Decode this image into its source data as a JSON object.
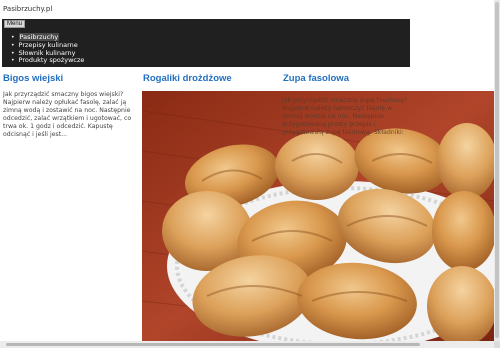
{
  "site": {
    "title": "Pasibrzuchy.pl"
  },
  "nav": {
    "toggle_label": "Menu",
    "items": [
      {
        "label": "Pasibrzuchy",
        "active": true
      },
      {
        "label": "Przepisy kulinarne",
        "active": false
      },
      {
        "label": "Słownik kulinarny",
        "active": false
      },
      {
        "label": "Produkty spożywcze",
        "active": false
      }
    ]
  },
  "posts": [
    {
      "title": "Bigos wiejski",
      "excerpt": "Jak przyrządzić smaczny bigos wiejski? Najpierw należy opłukać fasolę, zalać ją zimną wodą i zostawić na noc. Następnie odcedzić, zalać wrzątkiem i ugotować, co trwa ok. 1 godz i odcedzić. Kapustę odcisnąć i jeśli jest..."
    },
    {
      "title": "Rogaliki drożdżowe",
      "image": "crescent-rolls-photo"
    },
    {
      "title": "Zupa fasolowa",
      "excerpt": "Jak przyrządzić smaczną zupę fasolową? Najpierw należy namoczyć fasolę w zimnej wodzie na noc. Następnie przygotowaną prosty przepis i przygotowałą zupę fasolową. Składniki:"
    }
  ],
  "colors": {
    "link": "#2270c0",
    "nav_bg": "#202020",
    "text": "#444444"
  }
}
